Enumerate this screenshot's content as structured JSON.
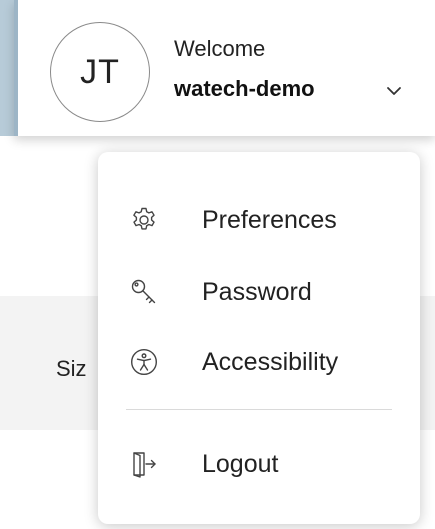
{
  "header": {
    "avatar_initials": "JT",
    "welcome_text": "Welcome",
    "username": "watech-demo"
  },
  "background": {
    "partial_label": "Siz"
  },
  "menu": {
    "items": [
      {
        "label": "Preferences",
        "icon": "gear-icon"
      },
      {
        "label": "Password",
        "icon": "key-icon"
      },
      {
        "label": "Accessibility",
        "icon": "accessibility-icon"
      },
      {
        "label": "Logout",
        "icon": "logout-icon"
      }
    ]
  },
  "colors": {
    "accent_edge": "#9db5c6",
    "text": "#222222",
    "divider": "#dadada",
    "panel_bg": "#f3f3f3"
  }
}
